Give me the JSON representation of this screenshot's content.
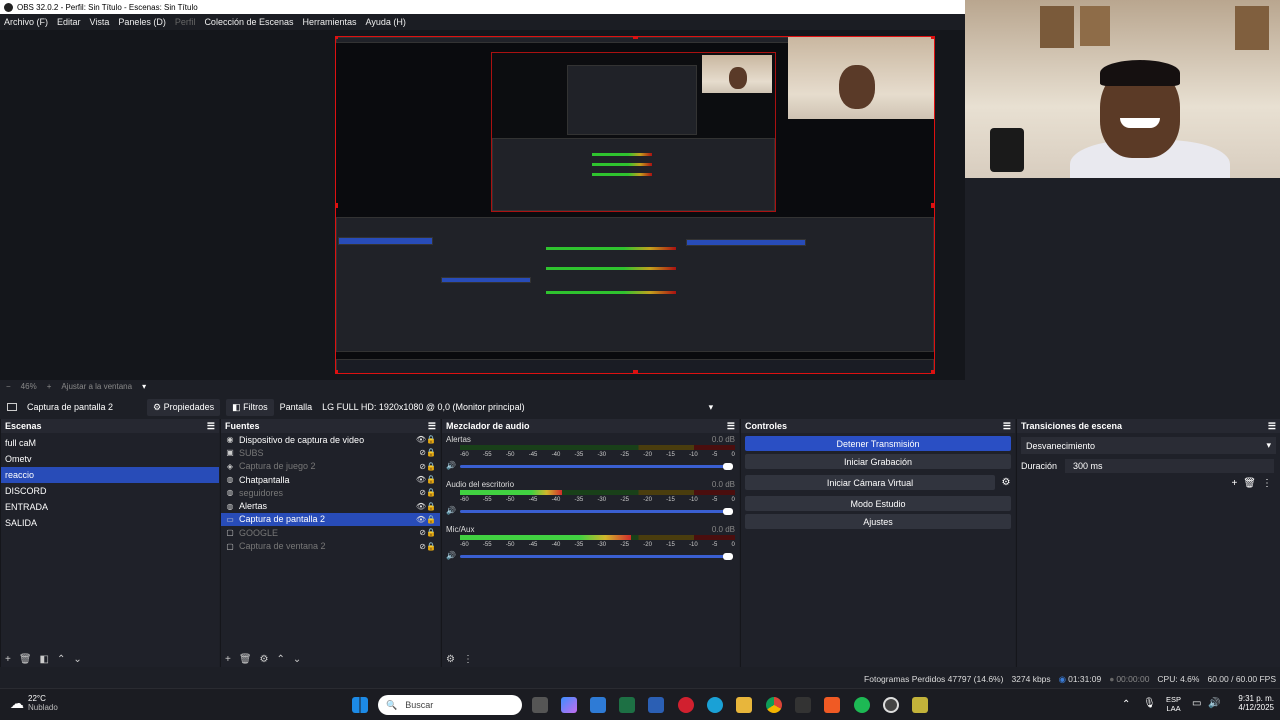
{
  "window": {
    "title": "OBS 32.0.2 - Perfil: Sin Título - Escenas: Sin Título"
  },
  "menu": [
    "Archivo (F)",
    "Editar",
    "Vista",
    "Paneles (D)",
    "Perfil",
    "Colección de Escenas",
    "Herramientas",
    "Ayuda (H)"
  ],
  "zoom": {
    "minus": "−",
    "value": "46%",
    "plus": "+",
    "fit_label": "Ajustar a la ventana",
    "arrow": "▾"
  },
  "sourcebar": {
    "source_name": "Captura de pantalla 2",
    "properties_label": "Propiedades",
    "filters_label": "Filtros",
    "display_label": "Pantalla",
    "display_value": "LG FULL HD: 1920x1080 @ 0,0 (Monitor principal)"
  },
  "scenes": {
    "title": "Escenas",
    "items": [
      "full caM",
      "Ometv",
      "reaccio",
      "DISCORD",
      "ENTRADA",
      "SALIDA"
    ],
    "selected": 2
  },
  "sources": {
    "title": "Fuentes",
    "items": [
      {
        "label": "Dispositivo de captura de video",
        "icon": "camera-icon",
        "dim": false,
        "selected": false
      },
      {
        "label": "SUBS",
        "icon": "image-icon",
        "dim": true,
        "selected": false
      },
      {
        "label": "Captura de juego 2",
        "icon": "gamepad-icon",
        "dim": true,
        "selected": false
      },
      {
        "label": "Chatpantalla",
        "icon": "browser-icon",
        "dim": false,
        "selected": false
      },
      {
        "label": "seguidores",
        "icon": "browser-icon",
        "dim": true,
        "selected": false
      },
      {
        "label": "Alertas",
        "icon": "browser-icon",
        "dim": false,
        "selected": false
      },
      {
        "label": "Captura de pantalla 2",
        "icon": "monitor-icon",
        "dim": false,
        "selected": true
      },
      {
        "label": "GOOGLE",
        "icon": "window-icon",
        "dim": true,
        "selected": false
      },
      {
        "label": "Captura de ventana 2",
        "icon": "window-icon",
        "dim": true,
        "selected": false
      }
    ]
  },
  "mixer": {
    "title": "Mezclador de audio",
    "scale": [
      "-60",
      "-55",
      "-50",
      "-45",
      "-40",
      "-35",
      "-30",
      "-25",
      "-20",
      "-15",
      "-10",
      "-5",
      "0"
    ],
    "channels": [
      {
        "name": "Alertas",
        "db": "0.0 dB",
        "level": 0.0
      },
      {
        "name": "Audio del escritorio",
        "db": "0.0 dB",
        "level": 0.37
      },
      {
        "name": "Mic/Aux",
        "db": "0.0 dB",
        "level": 0.62
      }
    ]
  },
  "controls": {
    "title": "Controles",
    "buttons": [
      "Detener Transmisión",
      "Iniciar Grabación",
      "Iniciar Cámara Virtual",
      "Modo Estudio",
      "Ajustes"
    ]
  },
  "transitions": {
    "title": "Transiciones de escena",
    "selected": "Desvanecimiento",
    "duration_label": "Duración",
    "duration_value": "300 ms"
  },
  "status": {
    "dropped": "Fotogramas Perdidos 47797 (14.6%)",
    "bitrate": "3274 kbps",
    "stream_time": "01:31:09",
    "rec_time": "00:00:00",
    "cpu": "CPU: 4.6%",
    "fps": "60.00 / 60.00 FPS"
  },
  "taskbar": {
    "weather_temp": "22°C",
    "weather_desc": "Nublado",
    "search_placeholder": "Buscar",
    "lang_top": "ESP",
    "lang_bottom": "LAA",
    "time": "9:31 p. m.",
    "date": "4/12/2025"
  },
  "colors": {
    "accent": "#284cb8",
    "record_border": "#dd1111"
  }
}
